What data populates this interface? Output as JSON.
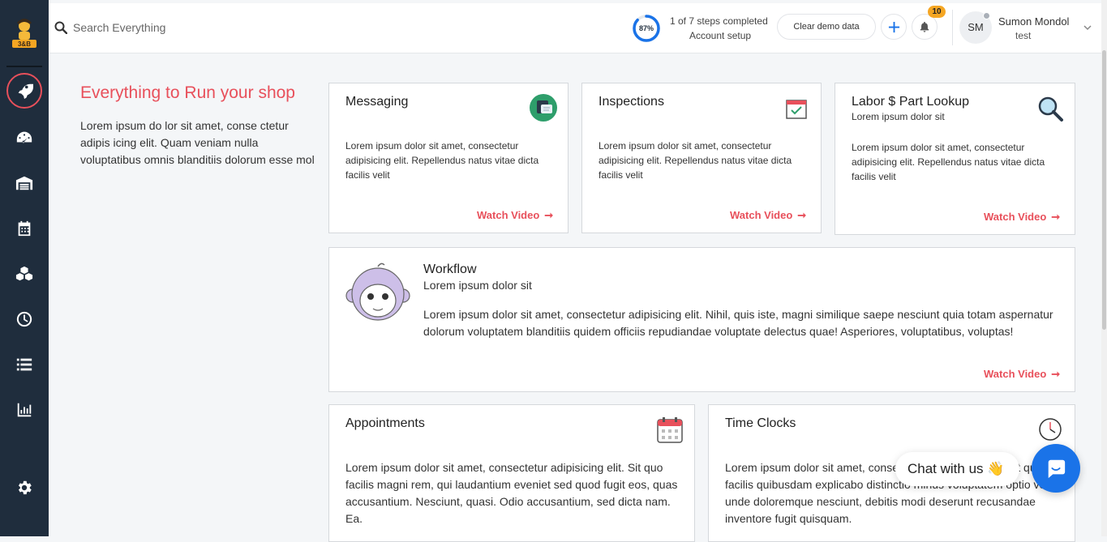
{
  "sidebar": {
    "items": [
      {
        "name": "rocket-icon",
        "label": "Getting started"
      },
      {
        "name": "dashboard-icon",
        "label": "Dashboard"
      },
      {
        "name": "garage-icon",
        "label": "Shop"
      },
      {
        "name": "calendar-icon",
        "label": "Calendar"
      },
      {
        "name": "boxes-icon",
        "label": "Inventory"
      },
      {
        "name": "clock-icon",
        "label": "Time clocks"
      },
      {
        "name": "list-icon",
        "label": "Lists"
      },
      {
        "name": "chart-icon",
        "label": "Reports"
      },
      {
        "name": "gear-icon",
        "label": "Settings"
      }
    ]
  },
  "header": {
    "search_placeholder": "Search Everything",
    "progress_percent": 87,
    "progress_label": "87%",
    "steps_text": "1 of 7 steps completed",
    "steps_sub": "Account setup",
    "clear_demo_label": "Clear demo data",
    "notifications_count": "10",
    "user_initials": "SM",
    "user_name": "Sumon Mondol",
    "user_role": "test",
    "accent_color": "#1a73e8"
  },
  "hero": {
    "title": "Everything to Run your shop",
    "text": "Lorem ipsum do lor sit amet, conse ctetur adipis icing elit. Quam veniam nulla voluptatibus omnis blanditiis dolorum esse mol"
  },
  "cards": {
    "messaging": {
      "title": "Messaging",
      "text": "Lorem ipsum dolor sit amet, consectetur adipisicing elit. Repellendus natus vitae dicta facilis velit",
      "link": "Watch Video"
    },
    "inspections": {
      "title": "Inspections",
      "text": "Lorem ipsum dolor sit amet, consectetur adipisicing elit. Repellendus natus vitae dicta facilis velit",
      "link": "Watch Video"
    },
    "labor": {
      "title": "Labor $ Part Lookup",
      "subtitle": "Lorem ipsum dolor sit",
      "text": "Lorem ipsum dolor sit amet, consectetur adipisicing elit. Repellendus natus vitae dicta facilis velit",
      "link": "Watch Video"
    },
    "workflow": {
      "title": "Workflow",
      "subtitle": "Lorem ipsum dolor sit",
      "text": "Lorem ipsum dolor sit amet, consectetur adipisicing elit. Nihil, quis iste, magni similique saepe nesciunt quia totam aspernatur dolorum voluptatem blanditiis quidem officiis repudiandae voluptate delectus quae! Asperiores, voluptatibus, voluptas!",
      "link": "Watch Video"
    },
    "appointments": {
      "title": "Appointments",
      "text": "Lorem ipsum dolor sit amet, consectetur adipisicing elit. Sit quo facilis magni rem, qui laudantium eveniet sed quod fugit eos, quas accusantium. Nesciunt, quasi. Odio accusantium, sed dicta nam. Ea."
    },
    "timeclocks": {
      "title": "Time Clocks",
      "text": "Lorem ipsum dolor sit amet, consectetur adipisicing elit. Sit quo facilis quibusdam explicabo distinctio minus voluptatem optio vel unde doloremque nesciunt, debitis modi deserunt recusandae inventore fugit quisquam."
    }
  },
  "arrow_glyph": "➞",
  "chat": {
    "label": "Chat with us 👋"
  },
  "colors": {
    "sidebar": "#1f2d3d",
    "accent_red": "#e8505b",
    "badge": "#f5a623",
    "chat_blue": "#1a73e8"
  }
}
